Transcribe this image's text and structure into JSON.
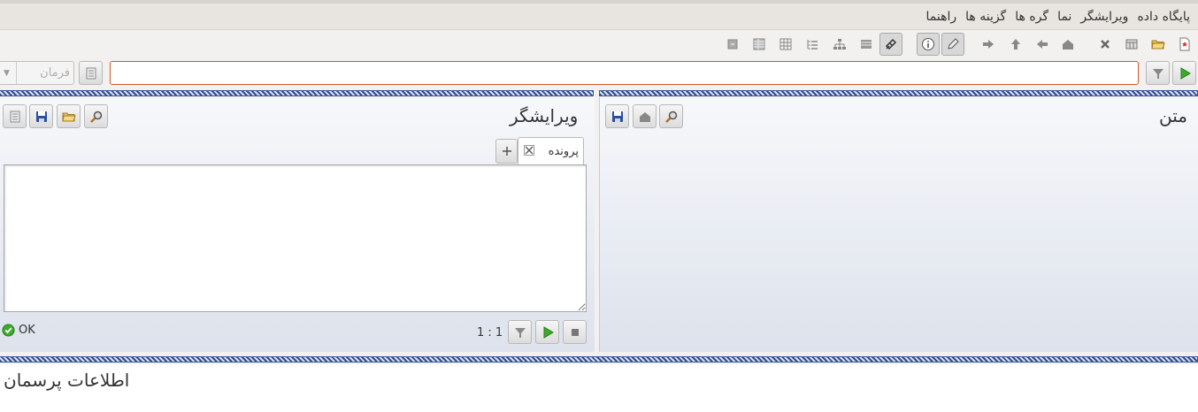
{
  "menu": {
    "items": [
      "پایگاه داده",
      "ویرایشگر",
      "نما",
      "گره ها",
      "گزینه ها",
      "راهنما"
    ]
  },
  "toolbar": {
    "icons": [
      "new-db-icon",
      "open-db-icon",
      "properties-icon",
      "close-db-icon",
      "home-icon",
      "back-icon",
      "up-icon",
      "forward-icon",
      "edit-icon",
      "info-icon",
      "filter-tree-icon",
      "table-icon",
      "tree-map-icon",
      "tree-list-icon",
      "grid-icon",
      "table-small-icon",
      "collapse-icon"
    ]
  },
  "command": {
    "value": "",
    "combo_label": "فرمان"
  },
  "text_panel": {
    "title": "متن"
  },
  "editor_panel": {
    "title": "ویرایشگر",
    "tab_label": "پرونده",
    "position": "1 : 1",
    "status": "OK",
    "content": ""
  },
  "info_panel": {
    "title": "اطلاعات پرسمان"
  },
  "colors": {
    "accent": "#d3582b",
    "hatch": "#2f4f8f",
    "ok_green": "#3cab2c"
  }
}
